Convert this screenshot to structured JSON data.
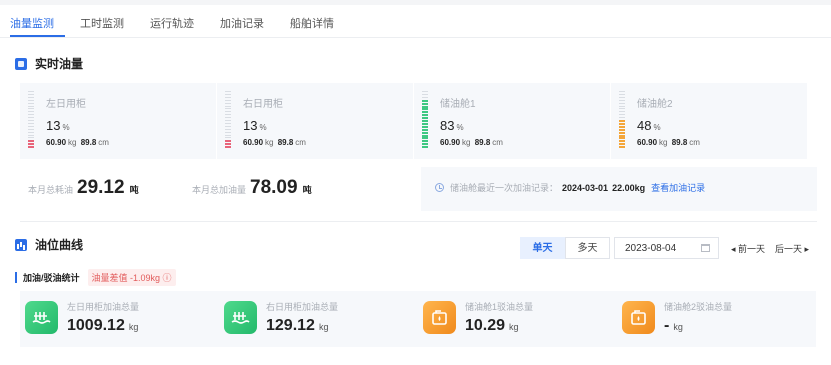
{
  "tabs": [
    "油量监测",
    "工时监测",
    "运行轨迹",
    "加油记录",
    "船舶详情"
  ],
  "section1_title": "实时油量",
  "tanks": [
    {
      "name": "左日用柜",
      "pct": "13",
      "unit": "%",
      "a": "60.90",
      "a_unit": "kg",
      "b": "89.8",
      "b_unit": "cm",
      "level": 0.13,
      "color": "#e8647a"
    },
    {
      "name": "右日用柜",
      "pct": "13",
      "unit": "%",
      "a": "60.90",
      "a_unit": "kg",
      "b": "89.8",
      "b_unit": "cm",
      "level": 0.13,
      "color": "#e8647a"
    },
    {
      "name": "储油舱1",
      "pct": "83",
      "unit": "%",
      "a": "60.90",
      "a_unit": "kg",
      "b": "89.8",
      "b_unit": "cm",
      "level": 0.83,
      "color": "#3ec882"
    },
    {
      "name": "储油舱2",
      "pct": "48",
      "unit": "%",
      "a": "60.90",
      "a_unit": "kg",
      "b": "89.8",
      "b_unit": "cm",
      "level": 0.48,
      "color": "#f4a63a"
    }
  ],
  "summary": {
    "consumption_label": "本月总耗油",
    "consumption_value": "29.12",
    "consumption_unit": "吨",
    "refuel_label": "本月总加油量",
    "refuel_value": "78.09",
    "refuel_unit": "吨"
  },
  "last_refuel": {
    "label": "储油舱最近一次加油记录：",
    "date": "2024-03-01",
    "amount": "22.00kg",
    "link": "查看加油记录"
  },
  "section2_title": "油位曲线",
  "controls": {
    "single_day": "单天",
    "multi_day": "多天",
    "date": "2023-08-04",
    "prev_day": "◂ 前一天",
    "next_day": "后一天 ▸"
  },
  "stats_head": {
    "title": "加油/驳油统计",
    "diff": "油量差值 -1.09kg ⓘ"
  },
  "stats": [
    {
      "name": "左日用柜加油总量",
      "value": "1009.12",
      "unit": "kg",
      "icon": "tank-fill-icon",
      "color": "green"
    },
    {
      "name": "右日用柜加油总量",
      "value": "129.12",
      "unit": "kg",
      "icon": "tank-fill-icon",
      "color": "green"
    },
    {
      "name": "储油舱1驳油总量",
      "value": "10.29",
      "unit": "kg",
      "icon": "oil-transfer-icon",
      "color": "orange"
    },
    {
      "name": "储油舱2驳油总量",
      "value": "-",
      "unit": "kg",
      "icon": "oil-transfer-icon",
      "color": "orange"
    }
  ]
}
